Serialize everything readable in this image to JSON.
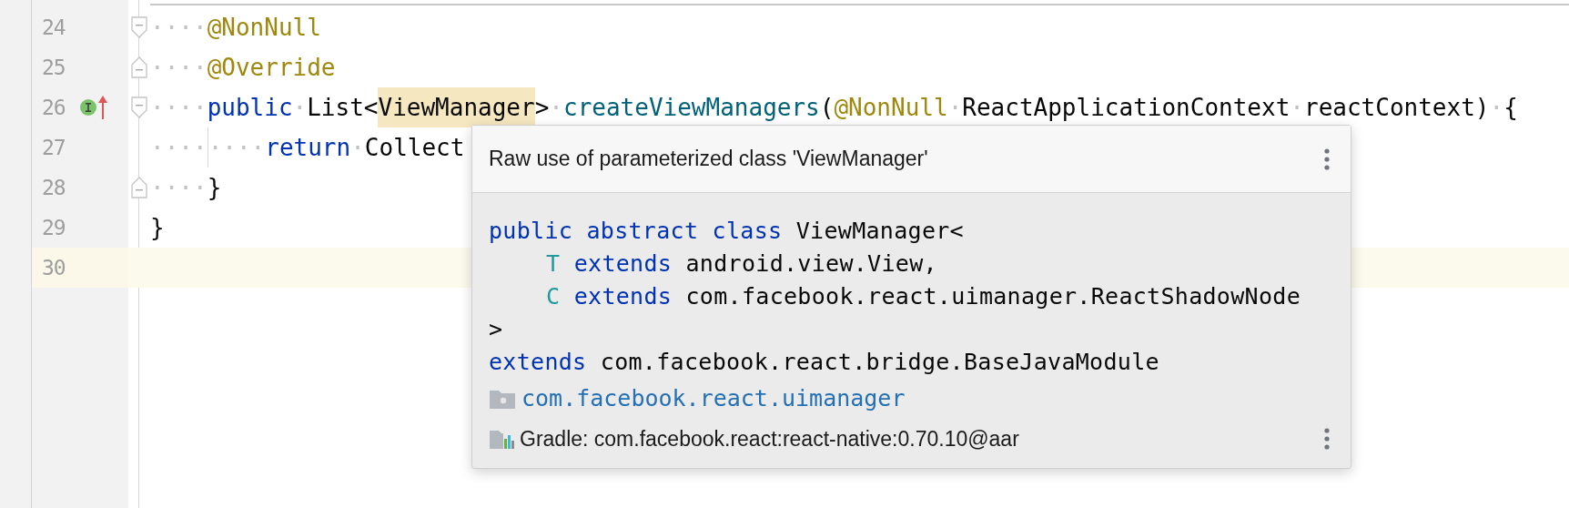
{
  "editor": {
    "lines": [
      {
        "number": "24",
        "current": false,
        "kind": "fold-start",
        "tokens": [
          {
            "kind": "ws",
            "text": "····"
          },
          {
            "kind": "annotation",
            "text": "@NonNull"
          }
        ]
      },
      {
        "number": "25",
        "current": false,
        "kind": "fold-end",
        "tokens": [
          {
            "kind": "ws",
            "text": "····"
          },
          {
            "kind": "annotation",
            "text": "@Override"
          }
        ]
      },
      {
        "number": "26",
        "current": false,
        "kind": "fold-start",
        "markers": [
          {
            "kind": "implemented"
          },
          {
            "kind": "overriding"
          }
        ],
        "tokens": [
          {
            "kind": "ws",
            "text": "····"
          },
          {
            "kind": "keyword",
            "text": "public"
          },
          {
            "kind": "ws",
            "text": "·"
          },
          {
            "kind": "plain",
            "text": "List<"
          },
          {
            "kind": "highlight",
            "text": "ViewManager"
          },
          {
            "kind": "plain",
            "text": ">"
          },
          {
            "kind": "ws",
            "text": "·"
          },
          {
            "kind": "method",
            "text": "createViewManagers"
          },
          {
            "kind": "plain",
            "text": "("
          },
          {
            "kind": "annotation",
            "text": "@NonNull"
          },
          {
            "kind": "ws",
            "text": "·"
          },
          {
            "kind": "plain",
            "text": "ReactApplicationContext"
          },
          {
            "kind": "ws",
            "text": "·"
          },
          {
            "kind": "plain",
            "text": "reactContext)"
          },
          {
            "kind": "ws",
            "text": "·"
          },
          {
            "kind": "plain",
            "text": "{"
          }
        ]
      },
      {
        "number": "27",
        "current": false,
        "kind": "code",
        "tokens": [
          {
            "kind": "ws",
            "text": "····"
          },
          {
            "kind": "guide"
          },
          {
            "kind": "ws",
            "text": "····"
          },
          {
            "kind": "keyword",
            "text": "return"
          },
          {
            "kind": "ws",
            "text": "·"
          },
          {
            "kind": "plain",
            "text": "Collect"
          }
        ]
      },
      {
        "number": "28",
        "current": false,
        "kind": "fold-end",
        "tokens": [
          {
            "kind": "ws",
            "text": "····"
          },
          {
            "kind": "plain",
            "text": "}"
          }
        ]
      },
      {
        "number": "29",
        "current": false,
        "kind": "code",
        "tokens": [
          {
            "kind": "plain",
            "text": "}"
          }
        ]
      },
      {
        "number": "30",
        "current": true,
        "kind": "code"
      }
    ]
  },
  "popup": {
    "title": "Raw use of parameterized class 'ViewManager'",
    "code_lines": [
      {
        "indented": false,
        "tokens": [
          {
            "kind": "keyword",
            "text": "public abstract class"
          },
          {
            "kind": "plain",
            "text": " ViewManager<"
          }
        ]
      },
      {
        "indented": true,
        "tokens": [
          {
            "kind": "typeparam",
            "text": "T"
          },
          {
            "kind": "keyword",
            "text": " extends"
          },
          {
            "kind": "plain",
            "text": " android.view.View,"
          }
        ]
      },
      {
        "indented": true,
        "tokens": [
          {
            "kind": "typeparam",
            "text": "C"
          },
          {
            "kind": "keyword",
            "text": " extends"
          },
          {
            "kind": "plain",
            "text": " com.facebook.react.uimanager.ReactShadowNode"
          }
        ]
      },
      {
        "indented": false,
        "tokens": [
          {
            "kind": "plain",
            "text": ">"
          }
        ]
      },
      {
        "indented": false,
        "tokens": [
          {
            "kind": "keyword",
            "text": "extends"
          },
          {
            "kind": "plain",
            "text": " com.facebook.react.bridge.BaseJavaModule"
          }
        ]
      }
    ],
    "locations": [
      {
        "kind": "package",
        "text": "com.facebook.react.uimanager"
      },
      {
        "kind": "library",
        "text": "Gradle: com.facebook.react:react-native:0.70.10@aar"
      }
    ]
  }
}
